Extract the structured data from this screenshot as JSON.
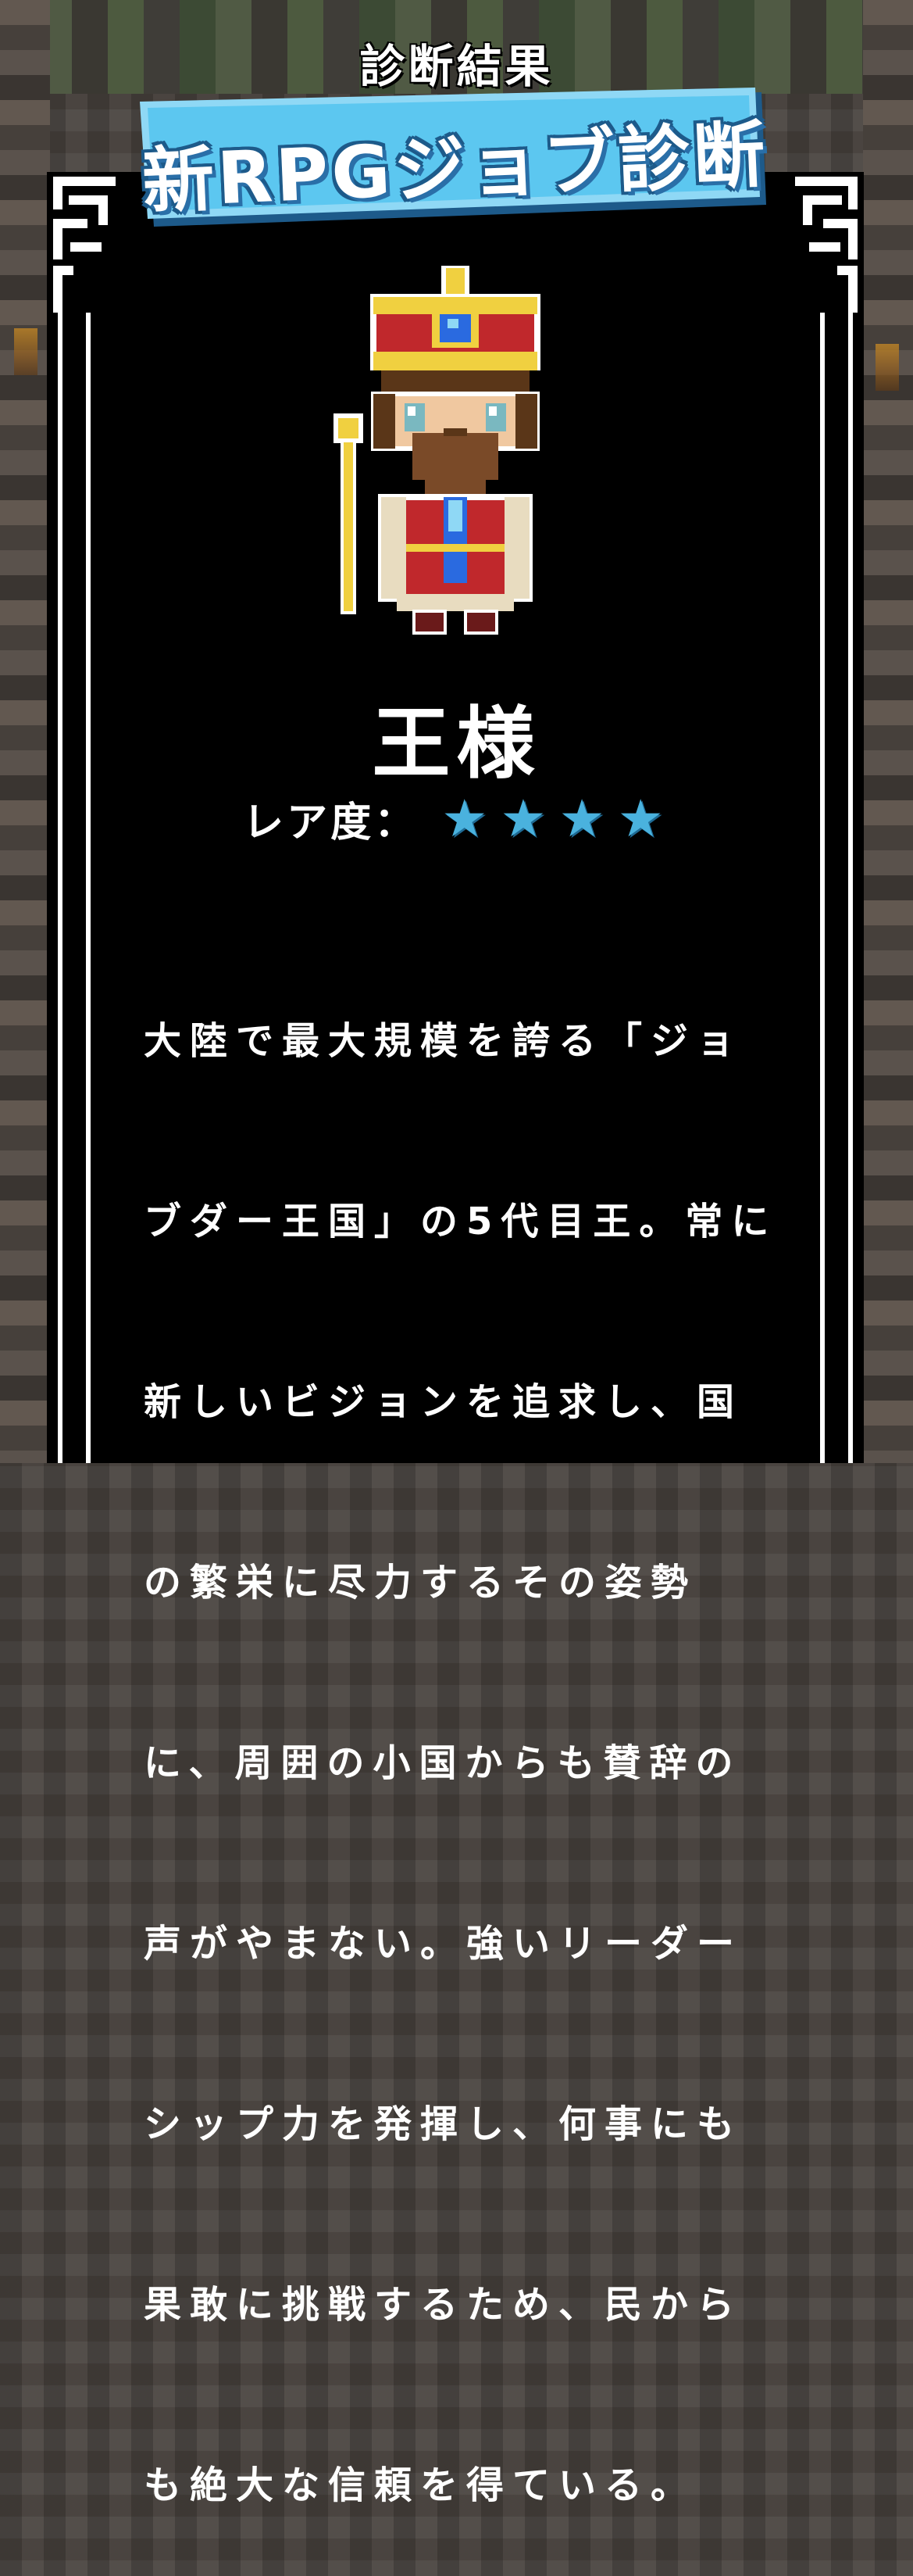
{
  "header": {
    "label": "診断結果"
  },
  "logo": {
    "title": "新RPGジョブ診断",
    "color_primary": "#5cc7f0",
    "color_shadow": "#2a6fa8"
  },
  "result": {
    "job_name": "王様",
    "rarity_label": "レア度：",
    "rarity_stars": 4,
    "rarity_max": 4,
    "star_color": "#4ab2de",
    "description_lines": [
      "大陸で最大規模を誇る「ジョ",
      "ブダー王国」の5代目王。常に",
      "新しいビジョンを追求し、国",
      "の繁栄に尽力するその姿勢",
      "に、周囲の小国からも賛辞の",
      "声がやまない。強いリーダー",
      "シップ力を発揮し、何事にも",
      "果敢に挑戦するため、民から",
      "も絶大な信頼を得ている。"
    ]
  },
  "character": {
    "icon": "king-sprite",
    "colors": {
      "crown": "#f0d040",
      "robe": "#c0282c",
      "gem": "#2a6ae0",
      "beard": "#7a4a28",
      "skin": "#f0c8a0"
    }
  }
}
